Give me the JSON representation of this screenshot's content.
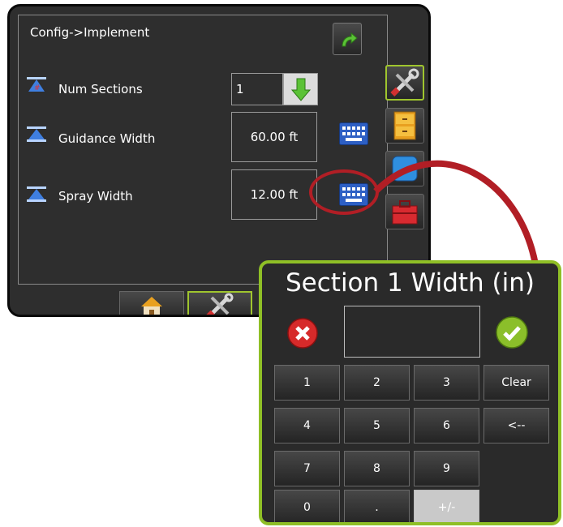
{
  "screen": {
    "title": "Config->Implement",
    "back_icon": "curved-arrow-icon"
  },
  "settings": [
    {
      "label": "Num Sections",
      "value": "1",
      "icon": "sections-icon"
    },
    {
      "label": "Guidance Width",
      "value": "60.00 ft",
      "icon": "width-icon"
    },
    {
      "label": "Spray Width",
      "value": "12.00 ft",
      "icon": "width-icon"
    }
  ],
  "side_tabs": [
    "tools-icon",
    "filing-cabinet-icon",
    "blue-tab-icon",
    "toolbox-icon"
  ],
  "bottom_tabs": [
    "home-icon",
    "tools-icon"
  ],
  "dialog": {
    "title": "Section 1 Width (in)",
    "display_value": "",
    "keys": [
      "1",
      "2",
      "3",
      "Clear",
      "4",
      "5",
      "6",
      "<--",
      "7",
      "8",
      "9",
      "0",
      ".",
      "+/-"
    ]
  },
  "colors": {
    "accent_green": "#8fbf26",
    "callout_red": "#b11e25",
    "cancel_red": "#d62a2a",
    "confirm_green": "#8bbf2a"
  }
}
